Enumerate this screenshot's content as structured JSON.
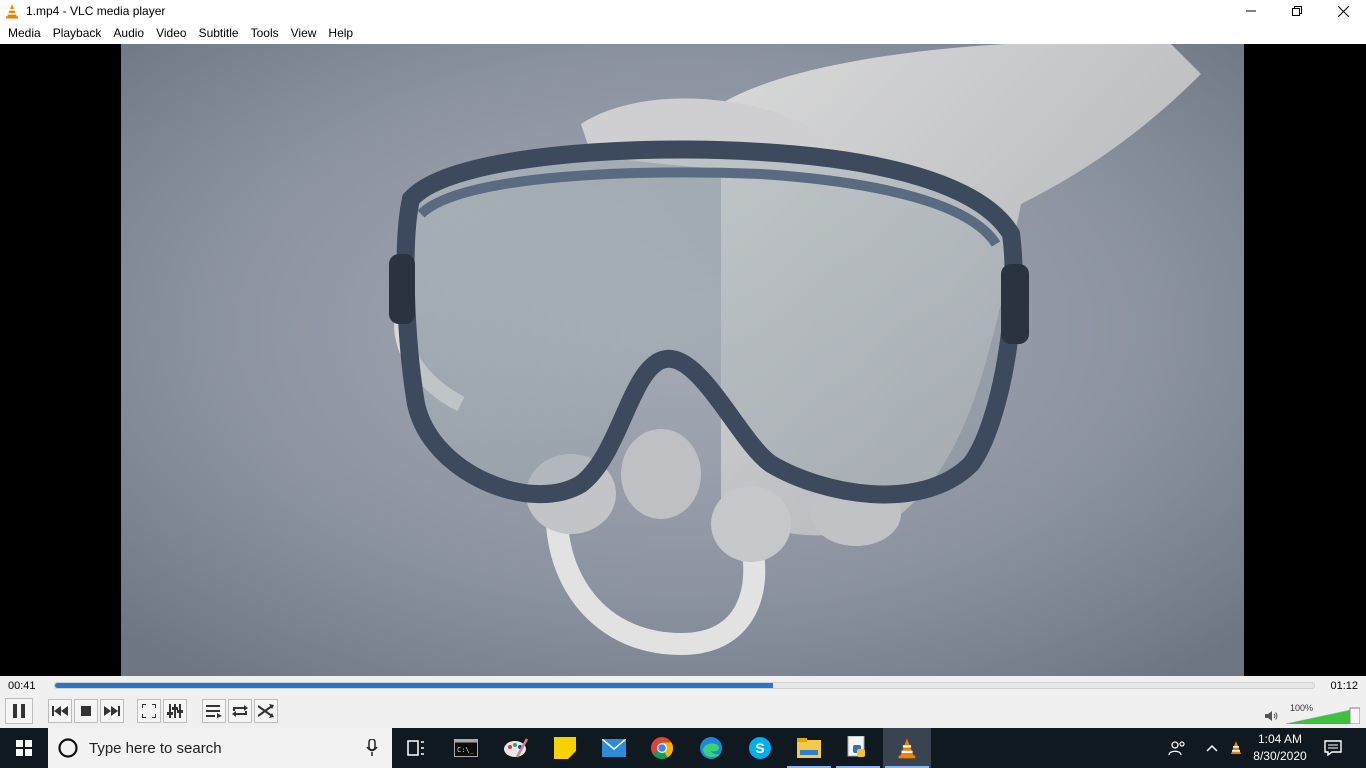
{
  "window": {
    "title": "1.mp4 - VLC media player"
  },
  "menu": {
    "items": [
      "Media",
      "Playback",
      "Audio",
      "Video",
      "Subtitle",
      "Tools",
      "View",
      "Help"
    ]
  },
  "player": {
    "elapsed": "00:41",
    "total": "01:12",
    "progress_fraction": 0.57,
    "volume_label": "100%",
    "volume_fraction": 1.0
  },
  "taskbar": {
    "search_placeholder": "Type here to search",
    "time": "1:04 AM",
    "date": "8/30/2020",
    "pinned_icons": [
      "task-view-icon",
      "terminal-icon",
      "paint-icon",
      "sticky-notes-icon",
      "mail-icon",
      "chrome-icon",
      "edge-icon",
      "skype-icon",
      "file-explorer-icon",
      "python-icon",
      "vlc-icon"
    ]
  },
  "colors": {
    "accent": "#2b72c9",
    "vlc_orange": "#f08000",
    "taskbar_bg": "#101820"
  }
}
